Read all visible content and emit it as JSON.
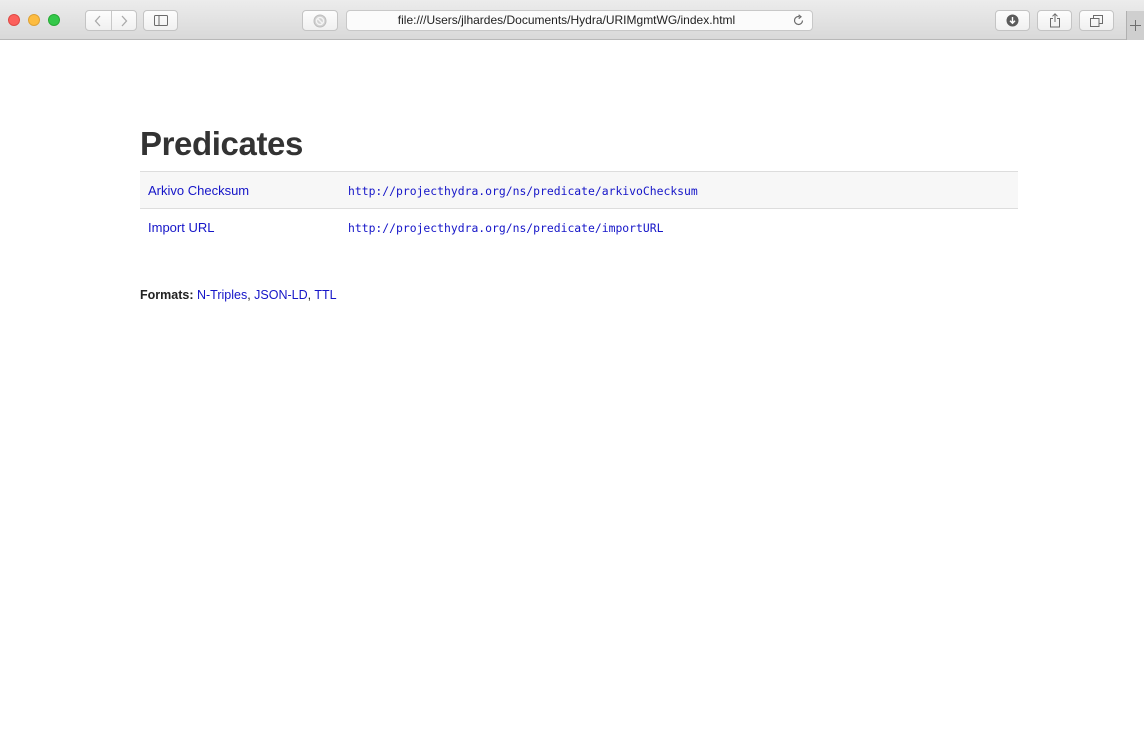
{
  "browser": {
    "url": "file:///Users/jlhardes/Documents/Hydra/URIMgmtWG/index.html"
  },
  "page": {
    "title": "Predicates",
    "predicates": [
      {
        "label": "Arkivo Checksum",
        "uri": "http://projecthydra.org/ns/predicate/arkivoChecksum"
      },
      {
        "label": "Import URL",
        "uri": "http://projecthydra.org/ns/predicate/importURL"
      }
    ],
    "formats": {
      "label": "Formats:",
      "links": [
        "N-Triples",
        "JSON-LD",
        "TTL"
      ],
      "separator": ","
    }
  },
  "colors": {
    "link": "#1515c8",
    "title": "#333333",
    "row_stripe": "#f7f7f7"
  }
}
